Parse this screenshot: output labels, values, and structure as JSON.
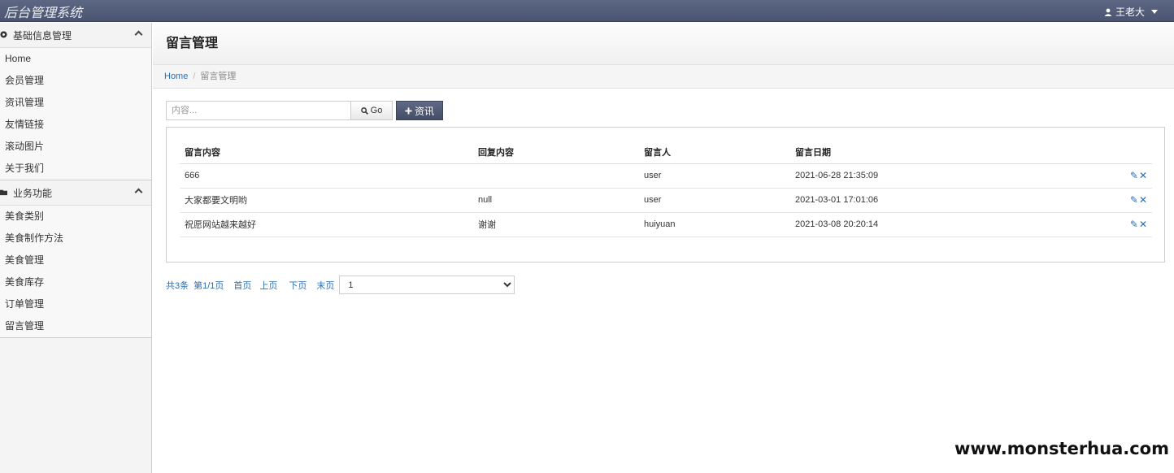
{
  "app": {
    "title": "后台管理系统",
    "user_name": "王老大"
  },
  "sidebar": {
    "groups": [
      {
        "title": "基础信息管理",
        "items": [
          "Home",
          "会员管理",
          "资讯管理",
          "友情链接",
          "滚动图片",
          "关于我们"
        ]
      },
      {
        "title": "业务功能",
        "items": [
          "美食类别",
          "美食制作方法",
          "美食管理",
          "美食库存",
          "订单管理",
          "留言管理"
        ]
      }
    ]
  },
  "page": {
    "title": "留言管理",
    "breadcrumb": {
      "home": "Home",
      "current": "留言管理"
    }
  },
  "toolbar": {
    "search_placeholder": "内容...",
    "go_label": "Go",
    "add_label": "资讯"
  },
  "table": {
    "headers": [
      "留言内容",
      "回复内容",
      "留言人",
      "留言日期"
    ],
    "rows": [
      {
        "content": "666",
        "reply": "",
        "author": "user",
        "date": "2021-06-28 21:35:09"
      },
      {
        "content": "大家都要文明哟",
        "reply": "null",
        "author": "user",
        "date": "2021-03-01 17:01:06"
      },
      {
        "content": "祝愿网站越来越好",
        "reply": "谢谢",
        "author": "huiyuan",
        "date": "2021-03-08 20:20:14"
      }
    ]
  },
  "pager": {
    "total": "共3条",
    "page_info": "第1/1页",
    "first": "首页",
    "prev": "上页",
    "next": "下页",
    "last": "末页",
    "selected_page": "1"
  },
  "watermark": "www.monsterhua.com",
  "colors": {
    "navbar": "#525c78",
    "link": "#2a6fb3",
    "add_button": "#4d5670"
  },
  "icons": {
    "user": "user-icon",
    "dashboard": "dashboard-icon",
    "folder": "folder-icon",
    "search": "search-icon",
    "plus": "plus-icon",
    "edit": "pencil-icon",
    "delete": "x-icon"
  }
}
